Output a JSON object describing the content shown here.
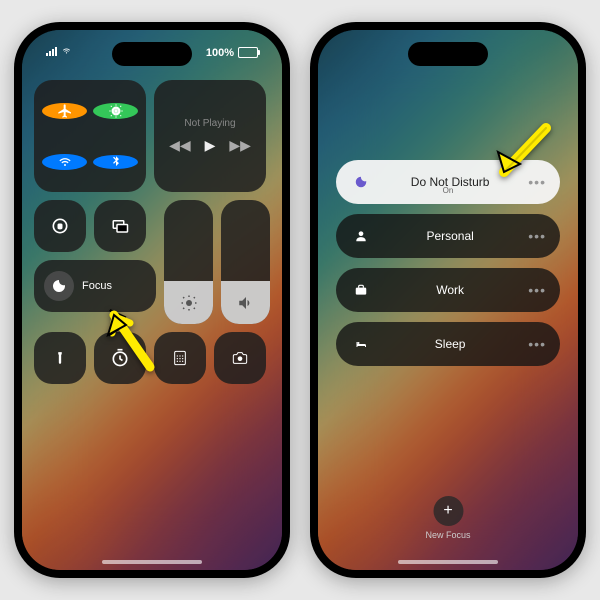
{
  "status": {
    "battery_pct": "100%"
  },
  "cc": {
    "music_title": "Not Playing",
    "focus_label": "Focus"
  },
  "focus_menu": {
    "items": [
      {
        "label": "Do Not Disturb",
        "sub": "On"
      },
      {
        "label": "Personal"
      },
      {
        "label": "Work"
      },
      {
        "label": "Sleep"
      }
    ],
    "new_label": "New Focus"
  }
}
